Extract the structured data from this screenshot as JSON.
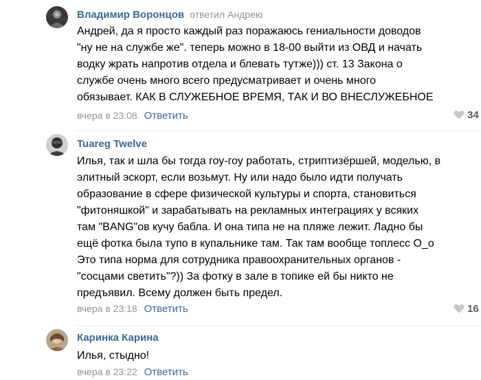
{
  "comments": [
    {
      "author": "Владимир Воронцов",
      "reply_to": "ответил Андрею",
      "lines": [
        "Андрей, да я просто каждый раз поражаюсь гениальности доводов",
        "\"ну не на службе же\". теперь можно в 18-00 выйти из ОВД и начать",
        "водку жрать напротив отдела и блевать тутже))) ст. 13 Закона о",
        "службе очень много всего предусматривает и очень много",
        "обязывает. КАК В СЛУЖЕБНОЕ ВРЕМЯ, ТАК И ВО ВНЕСЛУЖЕБНОЕ"
      ],
      "time": "вчера в 23:08",
      "reply_label": "Ответить",
      "likes": "34"
    },
    {
      "author": "Tuareg Twelve",
      "reply_to": "",
      "lines": [
        "Илья, так и шла бы тогда гоу-гоу работать, стриптизёршей, моделью, в",
        "элитный эскорт, если возьмут. Ну или надо было идти получать",
        "образование в сфере физической культуры и спорта, становиться",
        "\"фитоняшкой\" и зарабатывать на рекламных интеграциях у всяких",
        "там \"BANG\"ов кучу бабла. И она типа не на пляже лежит. Ладно бы",
        "ещё фотка была тупо в купальнике там. Так там вообще топлесс О_о",
        "Это типа норма для сотрудника правоохранительных органов -",
        "\"сосцами светить\"?)) За фотку в зале в топике ей бы никто не",
        "предъявил. Всему должен быть предел."
      ],
      "time": "вчера в 23:18",
      "reply_label": "Ответить",
      "likes": "16"
    },
    {
      "author": "Каринка Карина",
      "reply_to": "",
      "lines": [
        "Илья, стыдно!"
      ],
      "time": "вчера в 23:22",
      "reply_label": "Ответить",
      "likes": ""
    }
  ],
  "colors": {
    "link": "#3d6898",
    "muted": "#939393",
    "divider": "#e7e8ec"
  }
}
